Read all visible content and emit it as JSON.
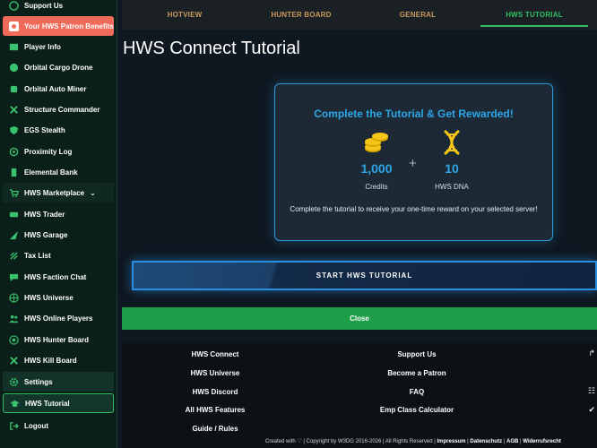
{
  "sidebar": {
    "items": [
      {
        "label": "Support Us",
        "icon": "support-icon"
      },
      {
        "label": "Your HWS Patron Benefits",
        "icon": "patreon-icon"
      },
      {
        "label": "Player Info",
        "icon": "player-icon"
      },
      {
        "label": "Orbital Cargo Drone",
        "icon": "drone-icon"
      },
      {
        "label": "Orbital Auto Miner",
        "icon": "miner-icon"
      },
      {
        "label": "Structure Commander",
        "icon": "structure-icon"
      },
      {
        "label": "EGS Stealth",
        "icon": "stealth-icon"
      },
      {
        "label": "Proximity Log",
        "icon": "proximity-icon"
      },
      {
        "label": "Elemental Bank",
        "icon": "bank-icon"
      },
      {
        "label": "HWS Marketplace",
        "icon": "cart-icon"
      },
      {
        "label": "HWS Trader",
        "icon": "trader-icon"
      },
      {
        "label": "HWS Garage",
        "icon": "garage-icon"
      },
      {
        "label": "Tax List",
        "icon": "tax-icon"
      },
      {
        "label": "HWS Faction Chat",
        "icon": "chat-icon"
      },
      {
        "label": "HWS Universe",
        "icon": "globe-icon"
      },
      {
        "label": "HWS Online Players",
        "icon": "players-icon"
      },
      {
        "label": "HWS Hunter Board",
        "icon": "target-icon"
      },
      {
        "label": "HWS Kill Board",
        "icon": "skull-icon"
      },
      {
        "label": "Settings",
        "icon": "gear-icon"
      },
      {
        "label": "HWS Tutorial",
        "icon": "graduation-icon"
      },
      {
        "label": "Logout",
        "icon": "logout-icon"
      }
    ]
  },
  "tabs": [
    {
      "label": "HOTVIEW"
    },
    {
      "label": "HUNTER BOARD"
    },
    {
      "label": "GENERAL"
    },
    {
      "label": "HWS TUTORIAL"
    }
  ],
  "page_title": "HWS Connect Tutorial",
  "reward_card": {
    "title": "Complete the Tutorial & Get Rewarded!",
    "credits_value": "1,000",
    "credits_label": "Credits",
    "dna_value": "10",
    "dna_label": "HWS DNA",
    "plus": "+",
    "description": "Complete the tutorial to receive your one-time reward on your selected server!"
  },
  "start_button": "START HWS TUTORIAL",
  "close_button": "Close",
  "footer": {
    "col1": [
      "HWS Connect",
      "HWS Universe",
      "HWS Discord",
      "All HWS Features",
      "Guide / Rules"
    ],
    "col2": [
      "Support Us",
      "Become a Patron",
      "FAQ",
      "Emp Class Calculator"
    ],
    "copyright_prefix": "Created with ♡ | Copyright by W3DG 2016-2026 | All Rights Reserved |",
    "legal_links": [
      "Impressum",
      "Datenschutz",
      "AGB",
      "Widerrufsrecht"
    ]
  },
  "colors": {
    "accent_green": "#2fbf63",
    "accent_blue": "#2da6e8",
    "tab_inactive": "#c89a5d",
    "patron": "#f06b5a"
  }
}
